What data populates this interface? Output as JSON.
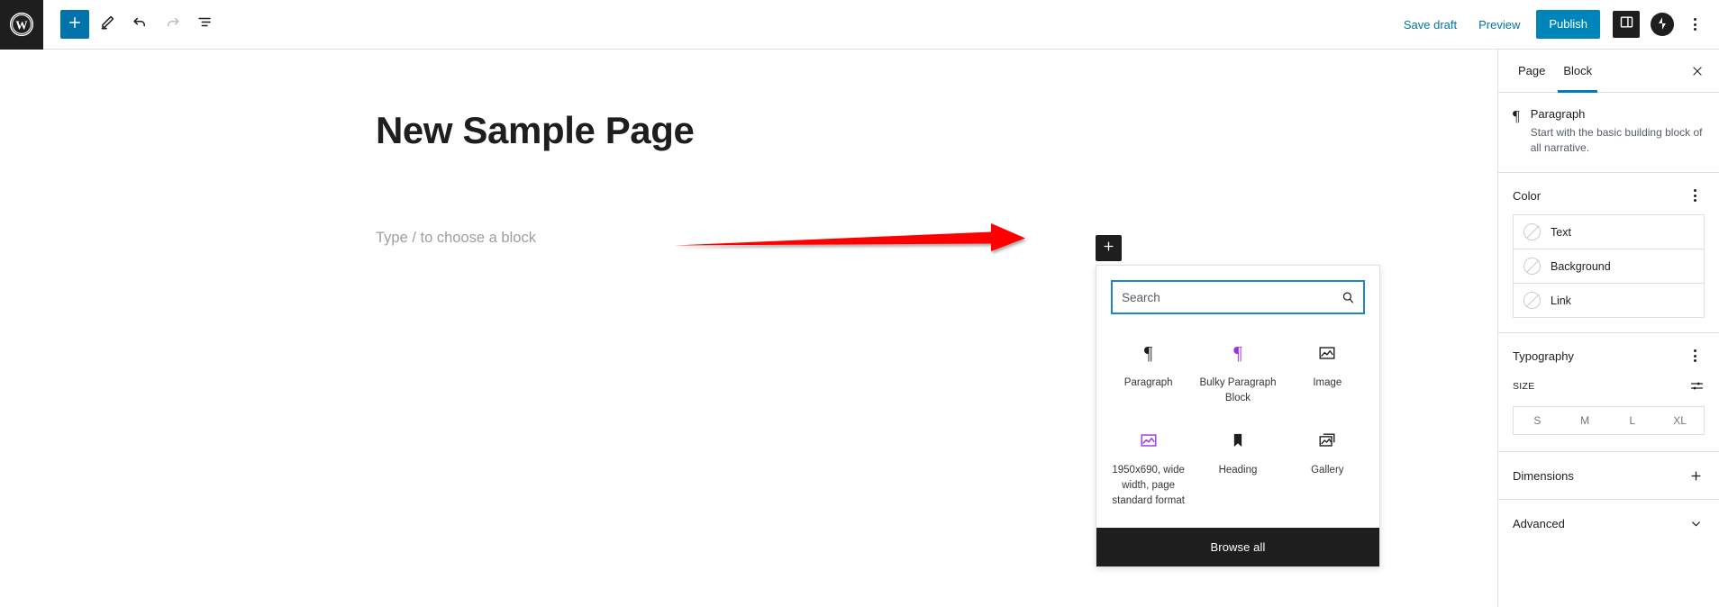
{
  "topbar": {
    "logo_icon": "wordpress-logo-icon",
    "tools": [
      {
        "name": "add-block-button",
        "icon": "plus-icon"
      },
      {
        "name": "edit-tool-button",
        "icon": "pencil-icon"
      },
      {
        "name": "undo-button",
        "icon": "undo-arrow-icon"
      },
      {
        "name": "redo-button",
        "icon": "redo-arrow-icon"
      },
      {
        "name": "list-view-button",
        "icon": "list-view-icon"
      }
    ],
    "save_draft_label": "Save draft",
    "preview_label": "Preview",
    "publish_label": "Publish",
    "settings_icon": "sidebar-panel-icon",
    "avatar_icon": "jetpack-avatar-icon",
    "options_icon": "kebab-menu-icon",
    "accent_color": "#0085ba",
    "link_color": "#0073aa"
  },
  "editor": {
    "post_title": "New Sample Page",
    "paragraph_placeholder": "Type / to choose a block",
    "annotation": {
      "type": "arrow",
      "color": "#ff0000",
      "points_to": "inserter-plus-button"
    }
  },
  "inserter": {
    "plus_icon": "plus-icon",
    "search": {
      "value": "",
      "placeholder": "Search",
      "icon": "search-icon"
    },
    "blocks": [
      {
        "label": "Paragraph",
        "icon": "paragraph-pilcrow-icon",
        "color": "#1e1e1e"
      },
      {
        "label": "Bulky Paragraph Block",
        "icon": "paragraph-pilcrow-icon",
        "color": "#9b30e0"
      },
      {
        "label": "Image",
        "icon": "image-icon",
        "color": "#1e1e1e"
      },
      {
        "label": "1950x690, wide width, page standard format",
        "icon": "image-icon",
        "color": "#9b30e0"
      },
      {
        "label": "Heading",
        "icon": "bookmark-heading-icon",
        "color": "#1e1e1e"
      },
      {
        "label": "Gallery",
        "icon": "gallery-icon",
        "color": "#1e1e1e"
      }
    ],
    "browse_all_label": "Browse all"
  },
  "sidebar": {
    "tabs": [
      {
        "label": "Page",
        "active": false
      },
      {
        "label": "Block",
        "active": true
      }
    ],
    "close_icon": "close-x-icon",
    "block_card": {
      "icon": "paragraph-pilcrow-icon",
      "name": "Paragraph",
      "description": "Start with the basic building block of all narrative."
    },
    "color": {
      "title": "Color",
      "options_icon": "kebab-menu-icon",
      "rows": [
        {
          "label": "Text",
          "swatch": "none"
        },
        {
          "label": "Background",
          "swatch": "none"
        },
        {
          "label": "Link",
          "swatch": "none"
        }
      ]
    },
    "typography": {
      "title": "Typography",
      "options_icon": "kebab-menu-icon",
      "size_label": "SIZE",
      "sliders_icon": "settings-sliders-icon",
      "sizes": [
        "S",
        "M",
        "L",
        "XL"
      ]
    },
    "dimensions": {
      "title": "Dimensions",
      "icon": "plus-icon"
    },
    "advanced": {
      "title": "Advanced",
      "icon": "chevron-down-icon"
    }
  }
}
